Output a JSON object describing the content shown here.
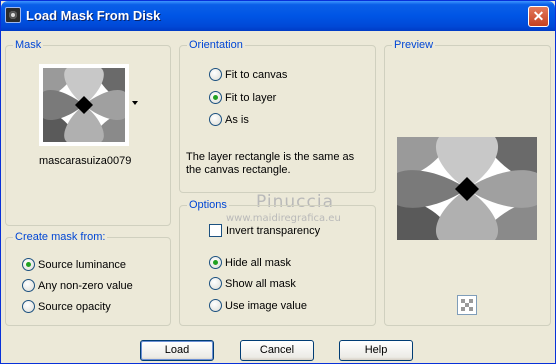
{
  "window": {
    "title": "Load Mask From Disk",
    "close_glyph": "✕"
  },
  "mask": {
    "legend": "Mask",
    "filename": "mascarasuiza0079"
  },
  "create_mask": {
    "legend": "Create mask from:",
    "options": [
      {
        "label": "Source luminance",
        "selected": true
      },
      {
        "label": "Any non-zero value",
        "selected": false
      },
      {
        "label": "Source opacity",
        "selected": false
      }
    ]
  },
  "orientation": {
    "legend": "Orientation",
    "options": [
      {
        "label": "Fit to canvas",
        "selected": false
      },
      {
        "label": "Fit to layer",
        "selected": true
      },
      {
        "label": "As is",
        "selected": false
      }
    ],
    "description": "The layer rectangle is the same as the canvas rectangle."
  },
  "options": {
    "legend": "Options",
    "invert_label": "Invert transparency",
    "invert_checked": false,
    "radios": [
      {
        "label": "Hide all mask",
        "selected": true
      },
      {
        "label": "Show all mask",
        "selected": false
      },
      {
        "label": "Use image value",
        "selected": false
      }
    ]
  },
  "preview": {
    "legend": "Preview"
  },
  "watermark": {
    "line1": "Pinuccia",
    "line2": "www.maidiregrafica.eu"
  },
  "buttons": {
    "load": "Load",
    "cancel": "Cancel",
    "help": "Help"
  }
}
